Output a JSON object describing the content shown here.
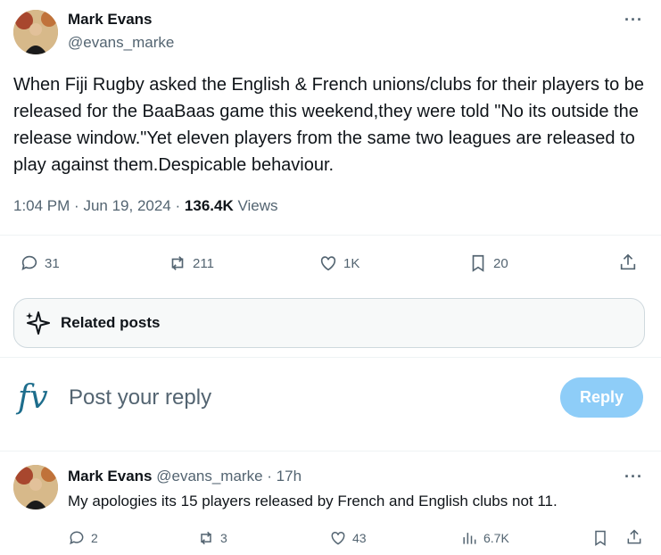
{
  "tweet": {
    "author_name": "Mark Evans",
    "author_handle": "@evans_marke",
    "more_label": "···",
    "text": "When Fiji Rugby asked the English & French unions/clubs for their players to be released for the BaaBaas game this weekend,they were told \"No its outside the release  window.\"Yet eleven players from the same two leagues are released to play against them.Despicable behaviour.",
    "time": "1:04 PM",
    "date": "Jun 19, 2024",
    "views_count": "136.4K",
    "views_label": "Views",
    "separator": "·",
    "actions": {
      "replies": "31",
      "reposts": "211",
      "likes": "1K",
      "bookmarks": "20"
    }
  },
  "related": {
    "label": "Related posts"
  },
  "composer": {
    "logo_text": "fv",
    "placeholder": "Post your reply",
    "reply_button": "Reply"
  },
  "reply": {
    "author_name": "Mark Evans",
    "author_handle": "@evans_marke",
    "time_ago": "· 17h",
    "more_label": "···",
    "text": "My apologies its 15 players released by French and English clubs not 11.",
    "actions": {
      "replies": "2",
      "reposts": "3",
      "likes": "43",
      "views": "6.7K"
    }
  },
  "colors": {
    "reply_button_bg": "#8ecdf8",
    "secondary_text": "#536471",
    "logo": "#1d6d8c"
  }
}
